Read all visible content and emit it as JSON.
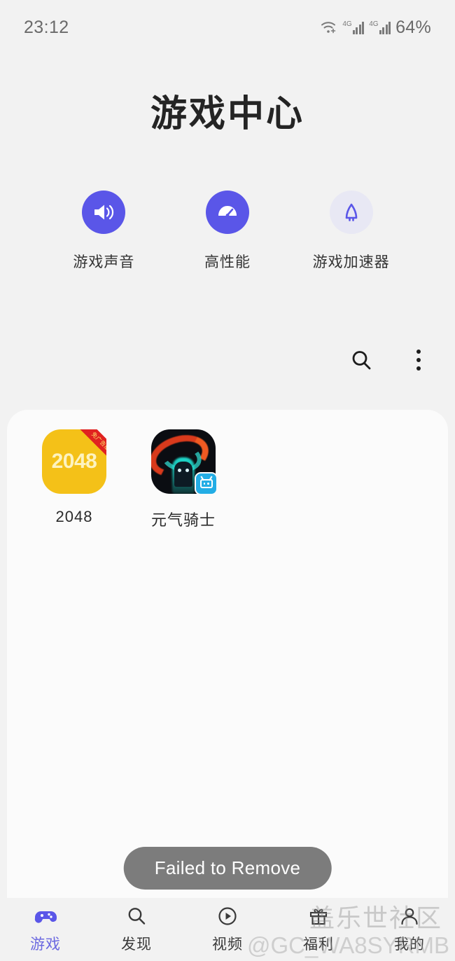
{
  "status_bar": {
    "time": "23:12",
    "battery": "64%",
    "wifi_icon": "wifi-icon",
    "signal_label_1": "4G",
    "signal_label_2": "4G"
  },
  "header": {
    "title": "游戏中心"
  },
  "quick_actions": [
    {
      "label": "游戏声音",
      "icon": "volume-icon",
      "bg": "#5a56e8",
      "fg": "#ffffff",
      "style": "filled"
    },
    {
      "label": "高性能",
      "icon": "performance-gauge-icon",
      "bg": "#5a56e8",
      "fg": "#ffffff",
      "style": "filled"
    },
    {
      "label": "游戏加速器",
      "icon": "rocket-boost-icon",
      "bg": "#e8e8f4",
      "fg": "#5a56e8",
      "style": "outline"
    }
  ],
  "toolbar": {
    "search_icon": "search-icon",
    "more_icon": "more-vertical-icon"
  },
  "apps": [
    {
      "name": "2048",
      "icon": "app-icon-2048",
      "icon_text": "2048",
      "badge_text": "免广告版",
      "icon_bg": "#f4c118",
      "icon_fg": "#fdf3c0",
      "ribbon_color": "#e02220"
    },
    {
      "name": "元气骑士",
      "icon": "app-icon-soul-knight",
      "badge_icon": "bilibili-badge-icon",
      "icon_bg": "#0b0d12"
    }
  ],
  "toast": {
    "message": "Failed to Remove",
    "bg": "#7c7c7c"
  },
  "bottom_nav": {
    "active_color": "#6b68e0",
    "items": [
      {
        "label": "游戏",
        "icon": "gamepad-icon",
        "active": true
      },
      {
        "label": "发现",
        "icon": "search-icon",
        "active": false
      },
      {
        "label": "视频",
        "icon": "play-circle-icon",
        "active": false
      },
      {
        "label": "福利",
        "icon": "gift-icon",
        "active": false
      },
      {
        "label": "我的",
        "icon": "person-icon",
        "active": false
      }
    ]
  },
  "watermark": {
    "line1": "盖乐世社区",
    "line2": "@GC_WA8SYRMB"
  }
}
